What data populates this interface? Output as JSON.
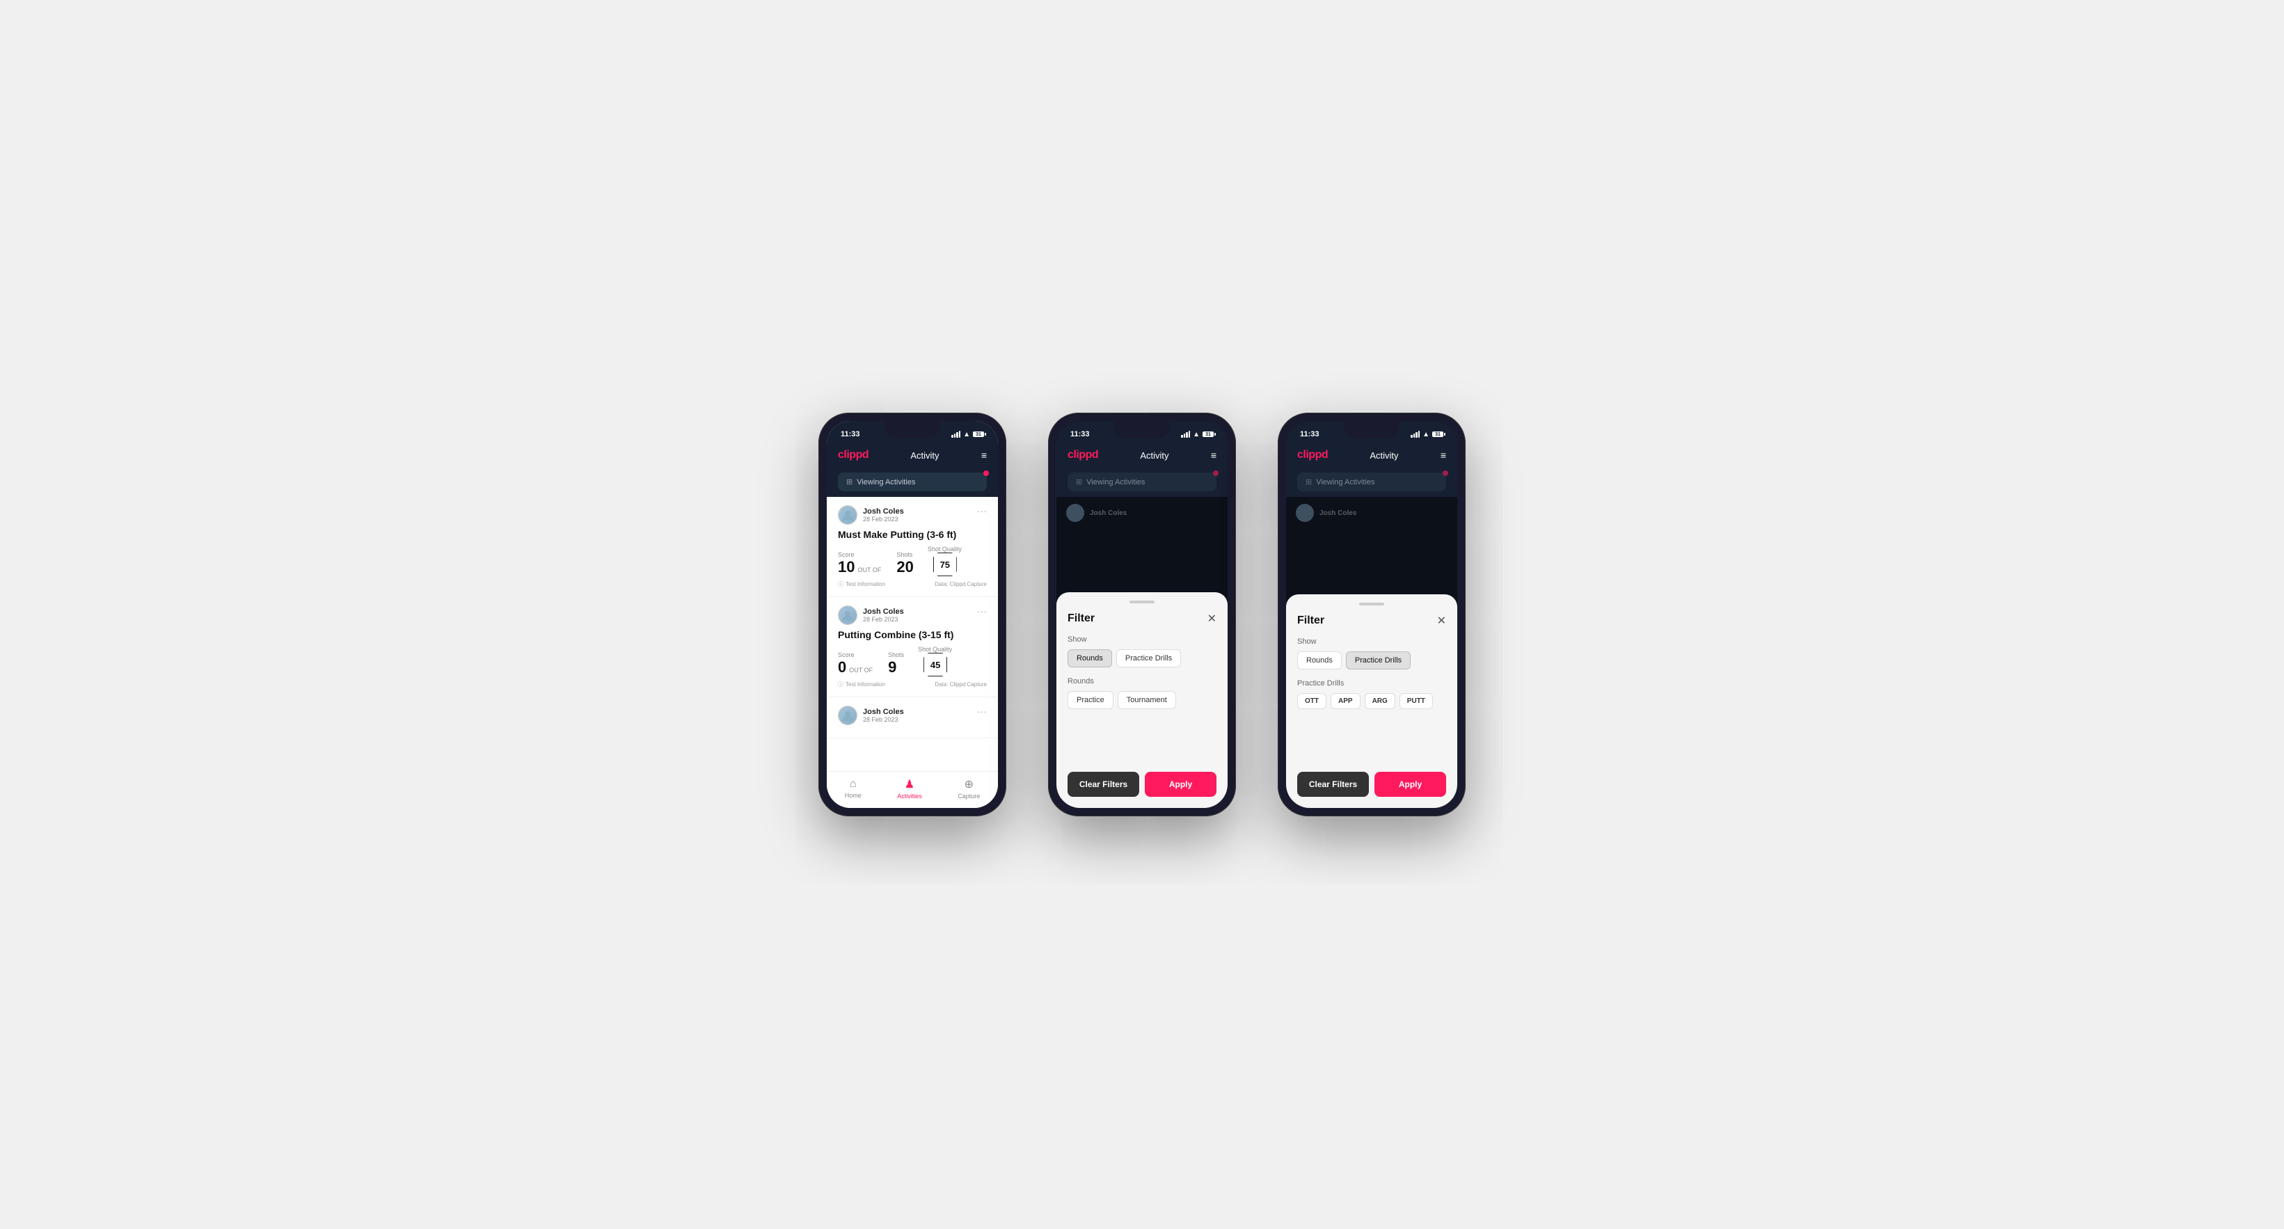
{
  "colors": {
    "brand": "#ff1a5e",
    "dark_bg": "#162032",
    "card_bg": "#243447",
    "text_primary": "#111",
    "text_secondary": "#888",
    "text_muted": "#999"
  },
  "phones": [
    {
      "id": "phone1",
      "status_bar": {
        "time": "11:33",
        "battery": "31"
      },
      "header": {
        "logo": "clippd",
        "title": "Activity",
        "menu": "≡"
      },
      "viewing_bar": {
        "icon": "⊞",
        "text": "Viewing Activities"
      },
      "activities": [
        {
          "user_name": "Josh Coles",
          "user_date": "28 Feb 2023",
          "title": "Must Make Putting (3-6 ft)",
          "score_label": "Score",
          "score_value": "10",
          "out_of_label": "OUT OF",
          "shots_label": "Shots",
          "shots_value": "20",
          "shot_quality_label": "Shot Quality",
          "shot_quality_value": "75",
          "test_info": "Test Information",
          "data_source": "Data: Clippd Capture"
        },
        {
          "user_name": "Josh Coles",
          "user_date": "28 Feb 2023",
          "title": "Putting Combine (3-15 ft)",
          "score_label": "Score",
          "score_value": "0",
          "out_of_label": "OUT OF",
          "shots_label": "Shots",
          "shots_value": "9",
          "shot_quality_label": "Shot Quality",
          "shot_quality_value": "45",
          "test_info": "Test Information",
          "data_source": "Data: Clippd Capture"
        },
        {
          "user_name": "Josh Coles",
          "user_date": "28 Feb 2023",
          "title": "",
          "score_label": "",
          "score_value": "",
          "out_of_label": "",
          "shots_label": "",
          "shots_value": "",
          "shot_quality_label": "",
          "shot_quality_value": "",
          "test_info": "",
          "data_source": ""
        }
      ],
      "bottom_nav": {
        "home_label": "Home",
        "activities_label": "Activities",
        "capture_label": "Capture"
      }
    },
    {
      "id": "phone2",
      "filter": {
        "title": "Filter",
        "show_label": "Show",
        "rounds_btn": "Rounds",
        "practice_drills_btn": "Practice Drills",
        "rounds_label": "Rounds",
        "practice_btn": "Practice",
        "tournament_btn": "Tournament",
        "clear_btn": "Clear Filters",
        "apply_btn": "Apply"
      }
    },
    {
      "id": "phone3",
      "filter": {
        "title": "Filter",
        "show_label": "Show",
        "rounds_btn": "Rounds",
        "practice_drills_btn": "Practice Drills",
        "practice_drills_label": "Practice Drills",
        "ott_btn": "OTT",
        "app_btn": "APP",
        "arg_btn": "ARG",
        "putt_btn": "PUTT",
        "clear_btn": "Clear Filters",
        "apply_btn": "Apply"
      }
    }
  ]
}
